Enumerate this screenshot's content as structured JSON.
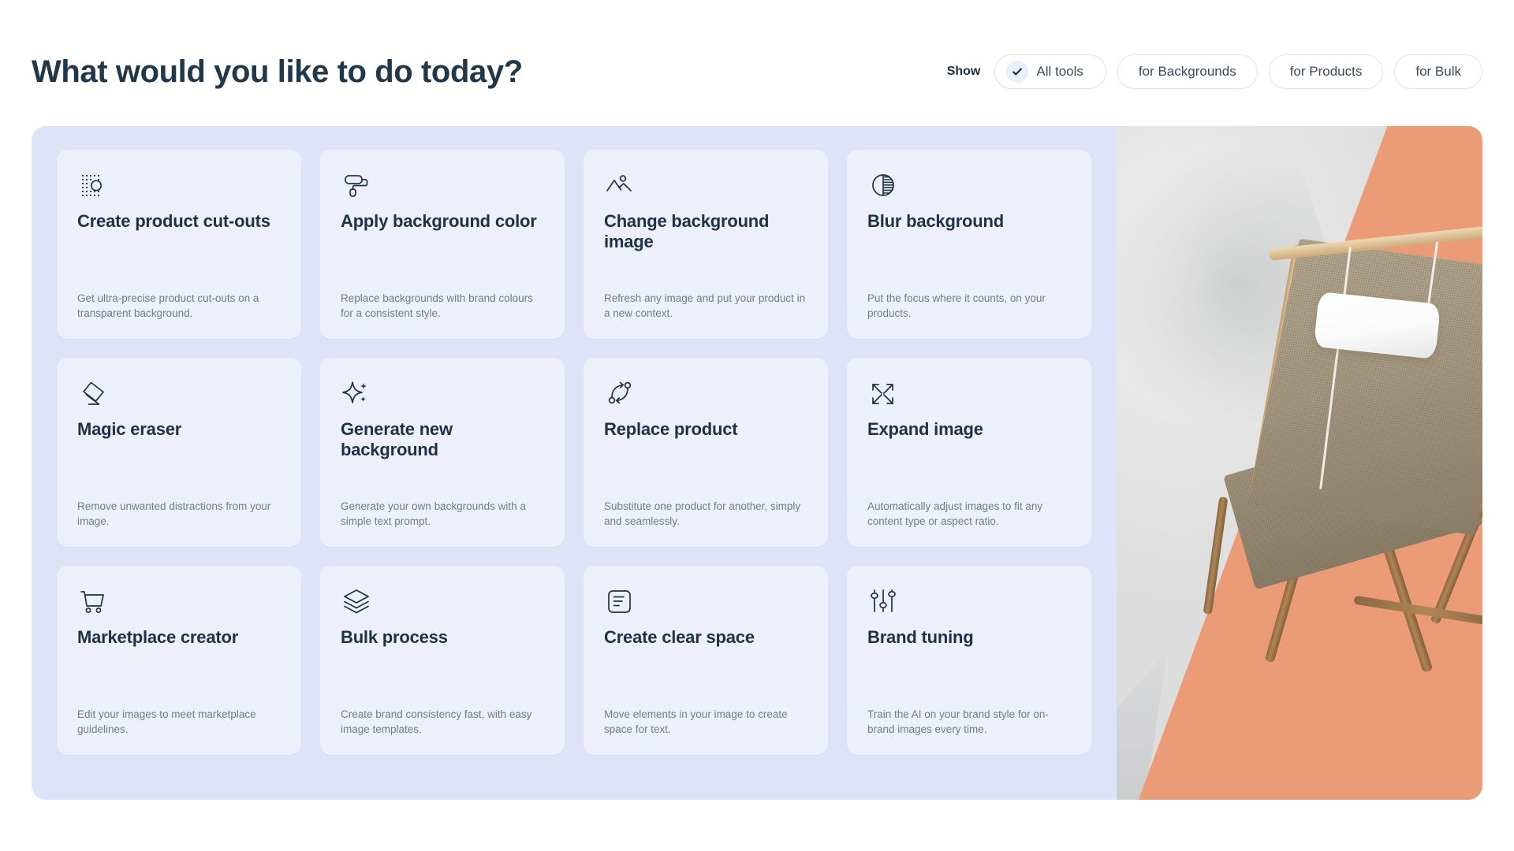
{
  "header": {
    "title": "What would you like to do today?",
    "show_label": "Show",
    "filters": [
      {
        "label": "All tools",
        "selected": true,
        "icon": "check-icon"
      },
      {
        "label": "for Backgrounds",
        "selected": false
      },
      {
        "label": "for Products",
        "selected": false
      },
      {
        "label": "for Bulk",
        "selected": false
      }
    ]
  },
  "tools": [
    {
      "icon": "cutout-dots-icon",
      "title": "Create product cut-outs",
      "desc": "Get ultra-precise product cut-outs on a transparent background."
    },
    {
      "icon": "paint-roller-icon",
      "title": "Apply background color",
      "desc": "Replace backgrounds with brand colours for a consistent style."
    },
    {
      "icon": "mountain-image-icon",
      "title": "Change background image",
      "desc": "Refresh any image and put your product in a new context."
    },
    {
      "icon": "contrast-circle-icon",
      "title": "Blur background",
      "desc": "Put the focus where it counts, on your products."
    },
    {
      "icon": "eraser-icon",
      "title": "Magic eraser",
      "desc": "Remove unwanted distractions from your image."
    },
    {
      "icon": "sparkle-icon",
      "title": "Generate new background",
      "desc": "Generate your own backgrounds with a simple text prompt."
    },
    {
      "icon": "swap-arrows-icon",
      "title": "Replace product",
      "desc": "Substitute one product for another, simply and seamlessly."
    },
    {
      "icon": "expand-arrows-icon",
      "title": "Expand image",
      "desc": "Automatically adjust images to fit any content type or aspect ratio."
    },
    {
      "icon": "shopping-cart-icon",
      "title": "Marketplace creator",
      "desc": "Edit your images to meet marketplace guidelines."
    },
    {
      "icon": "layers-icon",
      "title": "Bulk process",
      "desc": "Create brand consistency fast, with easy image templates."
    },
    {
      "icon": "text-frame-icon",
      "title": "Create clear space",
      "desc": "Move elements in your image to create space for text."
    },
    {
      "icon": "sliders-icon",
      "title": "Brand tuning",
      "desc": "Train the AI on your brand style for on-brand images every time."
    }
  ],
  "hero": {
    "alt": "deck-chair-product-photo",
    "colors": {
      "orange": "#EC9B77",
      "backdrop": "#E3E4E3",
      "wood": "#C9A274",
      "fabric": "#A99C84"
    }
  },
  "theme": {
    "panel_bg": "#DFE3F7",
    "card_bg": "#EDF0FB",
    "title_color": "#1D3244",
    "desc_color": "#6C7D8C"
  }
}
